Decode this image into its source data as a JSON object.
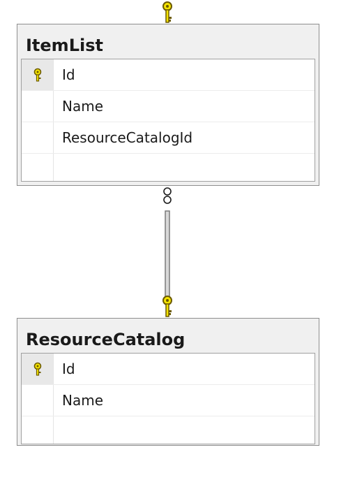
{
  "tables": [
    {
      "name": "ItemList",
      "columns": [
        {
          "name": "Id",
          "primary_key": true
        },
        {
          "name": "Name",
          "primary_key": false
        },
        {
          "name": "ResourceCatalogId",
          "primary_key": false
        }
      ]
    },
    {
      "name": "ResourceCatalog",
      "columns": [
        {
          "name": "Id",
          "primary_key": true
        },
        {
          "name": "Name",
          "primary_key": false
        }
      ]
    }
  ],
  "relationship": {
    "from": "ResourceCatalog",
    "to": "ItemList",
    "one_end_icon": "key-icon",
    "many_end_icon": "infinity-icon"
  },
  "colors": {
    "key_fill": "#f5e400",
    "key_stroke": "#6b5a00",
    "line": "#8a8a8a"
  }
}
